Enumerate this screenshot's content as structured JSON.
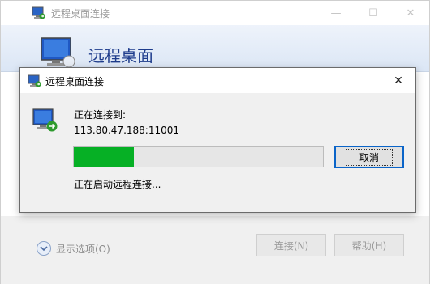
{
  "background_window": {
    "title": "远程桌面连接",
    "banner_title": "远程桌面",
    "show_options": "显示选项(O)",
    "connect_button": "连接(N)",
    "help_button": "帮助(H)",
    "minimize_glyph": "—",
    "maximize_glyph": "☐",
    "close_glyph": "✕"
  },
  "dialog": {
    "title": "远程桌面连接",
    "close_glyph": "✕",
    "connecting_label": "正在连接到:",
    "address": "113.80.47.188:11001",
    "progress_fraction": 0.24,
    "cancel_button": "取消",
    "status": "正在启动远程连接..."
  },
  "colors": {
    "progress_green": "#06b025",
    "banner_title_blue": "#1e3c8c",
    "focus_border": "#0a64c8"
  },
  "icons": [
    "remote-desktop-icon",
    "minimize-icon",
    "maximize-icon",
    "close-icon",
    "chevron-down-icon"
  ]
}
